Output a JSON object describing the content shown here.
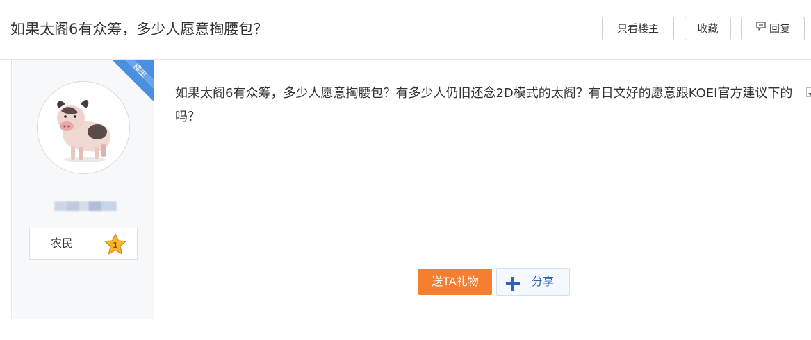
{
  "header": {
    "title": "如果太阁6有众筹，多少人愿意掏腰包？",
    "buttons": {
      "only_op": "只看楼主",
      "favorite": "收藏",
      "reply": "回复"
    }
  },
  "post": {
    "badge": "楼主",
    "author": {
      "rank_title": "农民",
      "level": "1"
    },
    "body": "如果太阁6有众筹，多少人愿意掏腰包？有多少人仍旧还念2D模式的太阁？有日文好的愿意跟KOEI官方建议下的吗？",
    "actions": {
      "gift": "送TA礼物",
      "share": "分享"
    }
  },
  "colors": {
    "ribbon": "#4a8fe0",
    "gift_button": "#f57e31",
    "share_text": "#2d64b3",
    "star": "#f7b52a"
  },
  "icons": [
    "reply-icon",
    "plus-icon",
    "star-icon",
    "dropdown-arrow-icon"
  ]
}
